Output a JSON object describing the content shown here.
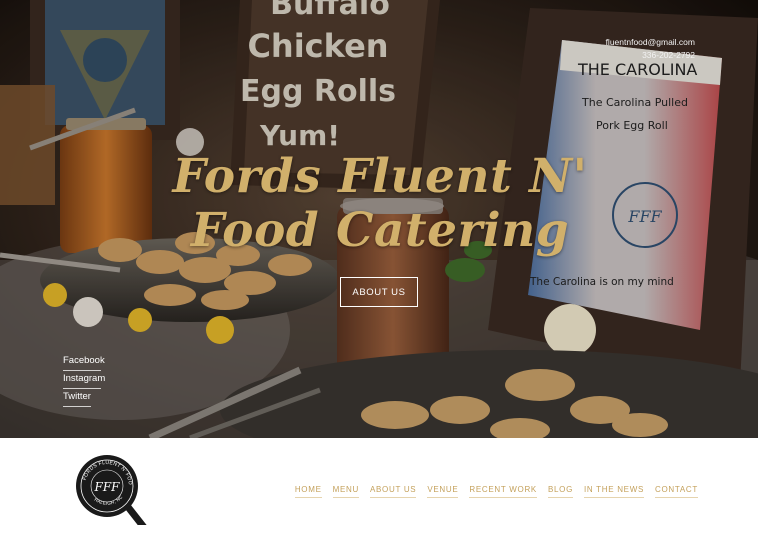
{
  "hero": {
    "contact": {
      "email": "fluentnfood@gmail.com",
      "phone": "336-202-2792"
    },
    "title_line1": "Fords Fluent N'",
    "title_line2": "Food Catering",
    "about_button": "ABOUT US",
    "scene_text": {
      "sign_line1": "Buffalo",
      "sign_line2": "Chicken",
      "sign_line3": "Egg Rolls",
      "sign_line4": "Yum!",
      "frame_heading": "THE CAROLINA",
      "frame_line1": "The Carolina Pulled",
      "frame_line2": "Pork Egg Roll",
      "frame_footer": "The Carolina is on my mind",
      "frame_seal": "FFF"
    }
  },
  "social": [
    "Facebook",
    "Instagram",
    "Twitter"
  ],
  "logo": {
    "ring_text": "FORDS FLUENT N' FOOD",
    "monogram": "FFF",
    "bottom_text": "RALEIGH, NC"
  },
  "nav": [
    "HOME",
    "MENU",
    "ABOUT US",
    "VENUE",
    "RECENT WORK",
    "BLOG",
    "IN THE NEWS",
    "CONTACT"
  ],
  "colors": {
    "accent_gold": "#d1b06b",
    "nav_gold": "#c4a15c",
    "hero_dark": "#1a120d"
  }
}
